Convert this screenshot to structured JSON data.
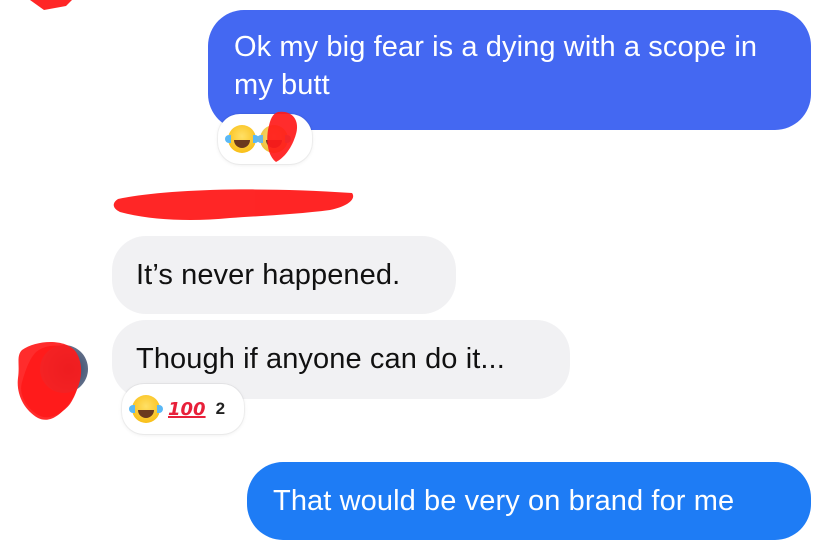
{
  "messages": [
    {
      "side": "outgoing",
      "text": "Ok my big fear is a dying with a scope in my butt",
      "reaction": {
        "emoji": "joy-emoji"
      }
    },
    {
      "side": "incoming",
      "text": "It’s never happened."
    },
    {
      "side": "incoming",
      "text": "Though if anyone can do it...",
      "reaction": {
        "emojis": [
          "joy-emoji",
          "hundred-points-emoji"
        ],
        "count": "2"
      }
    },
    {
      "side": "outgoing",
      "text": "That would be very on brand for me"
    }
  ],
  "emoji_glyphs": {
    "hundred": "100"
  },
  "colors": {
    "outgoing_bubble_1": "#4468f2",
    "outgoing_bubble_2": "#1e7cf5",
    "incoming_bubble": "#f1f1f3",
    "redaction": "#ff1a1a"
  }
}
